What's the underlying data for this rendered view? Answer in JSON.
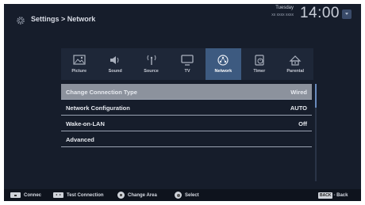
{
  "header": {
    "title": "Settings > Network",
    "settings_icon": "gear-icon"
  },
  "clock": {
    "day": "Tuesday",
    "date": "xx xxxx xxxx",
    "time": "14:00",
    "dropdown_icon": "chevron-down-icon"
  },
  "tabs": [
    {
      "label": "Picture",
      "icon": "picture-icon",
      "active": false
    },
    {
      "label": "Sound",
      "icon": "speaker-icon",
      "active": false
    },
    {
      "label": "Source",
      "icon": "antenna-icon",
      "active": false
    },
    {
      "label": "TV",
      "icon": "tv-icon",
      "active": false
    },
    {
      "label": "Network",
      "icon": "network-icon",
      "active": true
    },
    {
      "label": "Timer",
      "icon": "timer-icon",
      "active": false
    },
    {
      "label": "Parental",
      "icon": "parental-icon",
      "active": false
    }
  ],
  "menu": {
    "items": [
      {
        "label": "Change Connection Type",
        "value": "Wired",
        "selected": true
      },
      {
        "label": "Network Configuration",
        "value": "AUTO",
        "selected": false
      },
      {
        "label": "Wake-on-LAN",
        "value": "Off",
        "selected": false
      },
      {
        "label": "Advanced",
        "value": "",
        "selected": false
      }
    ]
  },
  "footer": {
    "connect": "Connec",
    "test_connection": "Test Connection",
    "change_area": "Change Area",
    "select": "Select",
    "back_key": "BACK",
    "back": "- Back"
  },
  "colors": {
    "background": "#161d2b",
    "active_tab": "#3d5a80",
    "selected_row": "#8c929d",
    "scroll_thumb": "#6a8bbd"
  }
}
